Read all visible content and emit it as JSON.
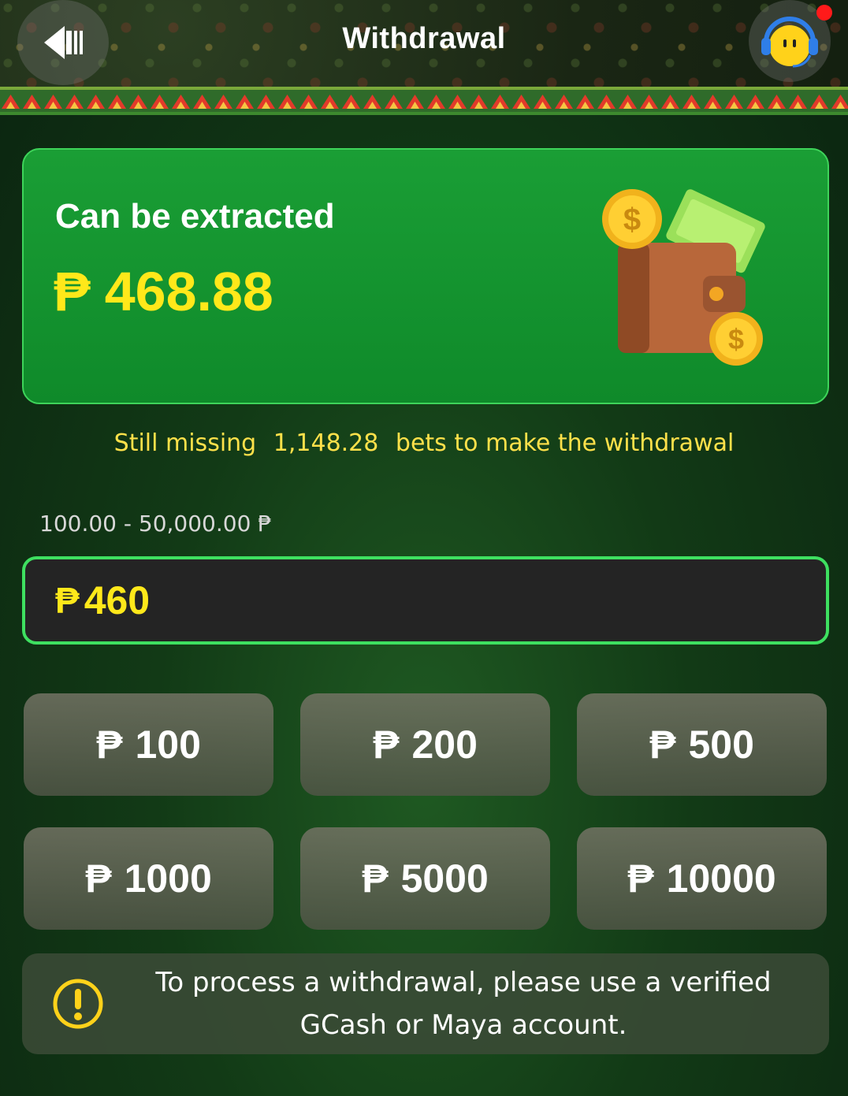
{
  "header": {
    "title": "Withdrawal",
    "back_icon": "back-arrow-icon",
    "support_icon": "support-headset-icon",
    "has_notification": true
  },
  "balance": {
    "label": "Can be extracted",
    "currency_symbol": "₱",
    "amount": "468.88"
  },
  "requirement": {
    "prefix": "Still missing",
    "value": "1,148.28",
    "suffix": "bets to make the withdrawal"
  },
  "withdraw_range": "100.00 - 50,000.00 ₱",
  "amount_input": {
    "currency_symbol": "₱",
    "value": "460"
  },
  "quick_amounts": [
    {
      "symbol": "₱",
      "label": "100"
    },
    {
      "symbol": "₱",
      "label": "200"
    },
    {
      "symbol": "₱",
      "label": "500"
    },
    {
      "symbol": "₱",
      "label": "1000"
    },
    {
      "symbol": "₱",
      "label": "5000"
    },
    {
      "symbol": "₱",
      "label": "10000"
    }
  ],
  "notice": {
    "icon": "warning-icon",
    "text": "To process a withdrawal, please use a verified GCash or Maya account."
  },
  "colors": {
    "accent_yellow": "#ffe81a",
    "card_green": "#1a9e35",
    "input_border": "#3ee060",
    "notify_red": "#ff1a1a"
  }
}
